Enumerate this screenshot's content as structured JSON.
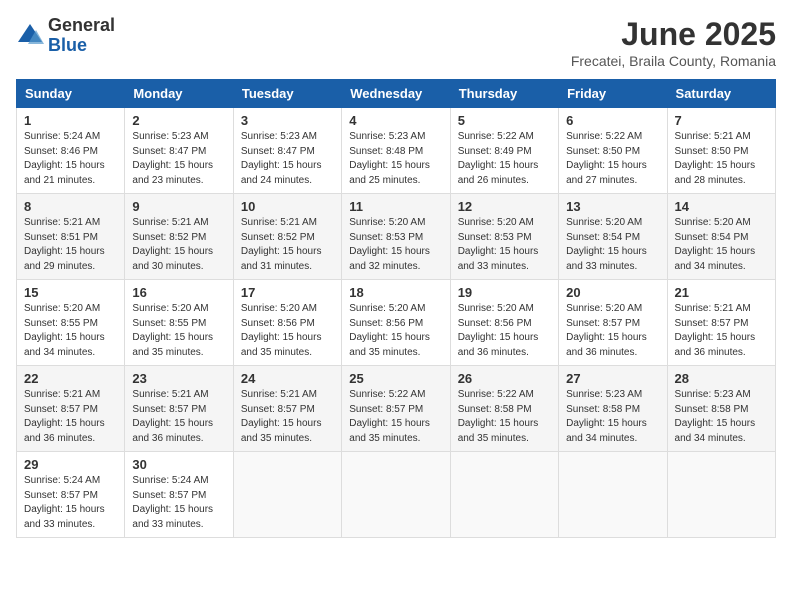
{
  "logo": {
    "general": "General",
    "blue": "Blue"
  },
  "title": "June 2025",
  "subtitle": "Frecatei, Braila County, Romania",
  "weekdays": [
    "Sunday",
    "Monday",
    "Tuesday",
    "Wednesday",
    "Thursday",
    "Friday",
    "Saturday"
  ],
  "weeks": [
    [
      {
        "day": "1",
        "sunrise": "5:24 AM",
        "sunset": "8:46 PM",
        "daylight": "15 hours and 21 minutes."
      },
      {
        "day": "2",
        "sunrise": "5:23 AM",
        "sunset": "8:47 PM",
        "daylight": "15 hours and 23 minutes."
      },
      {
        "day": "3",
        "sunrise": "5:23 AM",
        "sunset": "8:47 PM",
        "daylight": "15 hours and 24 minutes."
      },
      {
        "day": "4",
        "sunrise": "5:23 AM",
        "sunset": "8:48 PM",
        "daylight": "15 hours and 25 minutes."
      },
      {
        "day": "5",
        "sunrise": "5:22 AM",
        "sunset": "8:49 PM",
        "daylight": "15 hours and 26 minutes."
      },
      {
        "day": "6",
        "sunrise": "5:22 AM",
        "sunset": "8:50 PM",
        "daylight": "15 hours and 27 minutes."
      },
      {
        "day": "7",
        "sunrise": "5:21 AM",
        "sunset": "8:50 PM",
        "daylight": "15 hours and 28 minutes."
      }
    ],
    [
      {
        "day": "8",
        "sunrise": "5:21 AM",
        "sunset": "8:51 PM",
        "daylight": "15 hours and 29 minutes."
      },
      {
        "day": "9",
        "sunrise": "5:21 AM",
        "sunset": "8:52 PM",
        "daylight": "15 hours and 30 minutes."
      },
      {
        "day": "10",
        "sunrise": "5:21 AM",
        "sunset": "8:52 PM",
        "daylight": "15 hours and 31 minutes."
      },
      {
        "day": "11",
        "sunrise": "5:20 AM",
        "sunset": "8:53 PM",
        "daylight": "15 hours and 32 minutes."
      },
      {
        "day": "12",
        "sunrise": "5:20 AM",
        "sunset": "8:53 PM",
        "daylight": "15 hours and 33 minutes."
      },
      {
        "day": "13",
        "sunrise": "5:20 AM",
        "sunset": "8:54 PM",
        "daylight": "15 hours and 33 minutes."
      },
      {
        "day": "14",
        "sunrise": "5:20 AM",
        "sunset": "8:54 PM",
        "daylight": "15 hours and 34 minutes."
      }
    ],
    [
      {
        "day": "15",
        "sunrise": "5:20 AM",
        "sunset": "8:55 PM",
        "daylight": "15 hours and 34 minutes."
      },
      {
        "day": "16",
        "sunrise": "5:20 AM",
        "sunset": "8:55 PM",
        "daylight": "15 hours and 35 minutes."
      },
      {
        "day": "17",
        "sunrise": "5:20 AM",
        "sunset": "8:56 PM",
        "daylight": "15 hours and 35 minutes."
      },
      {
        "day": "18",
        "sunrise": "5:20 AM",
        "sunset": "8:56 PM",
        "daylight": "15 hours and 35 minutes."
      },
      {
        "day": "19",
        "sunrise": "5:20 AM",
        "sunset": "8:56 PM",
        "daylight": "15 hours and 36 minutes."
      },
      {
        "day": "20",
        "sunrise": "5:20 AM",
        "sunset": "8:57 PM",
        "daylight": "15 hours and 36 minutes."
      },
      {
        "day": "21",
        "sunrise": "5:21 AM",
        "sunset": "8:57 PM",
        "daylight": "15 hours and 36 minutes."
      }
    ],
    [
      {
        "day": "22",
        "sunrise": "5:21 AM",
        "sunset": "8:57 PM",
        "daylight": "15 hours and 36 minutes."
      },
      {
        "day": "23",
        "sunrise": "5:21 AM",
        "sunset": "8:57 PM",
        "daylight": "15 hours and 36 minutes."
      },
      {
        "day": "24",
        "sunrise": "5:21 AM",
        "sunset": "8:57 PM",
        "daylight": "15 hours and 35 minutes."
      },
      {
        "day": "25",
        "sunrise": "5:22 AM",
        "sunset": "8:57 PM",
        "daylight": "15 hours and 35 minutes."
      },
      {
        "day": "26",
        "sunrise": "5:22 AM",
        "sunset": "8:58 PM",
        "daylight": "15 hours and 35 minutes."
      },
      {
        "day": "27",
        "sunrise": "5:23 AM",
        "sunset": "8:58 PM",
        "daylight": "15 hours and 34 minutes."
      },
      {
        "day": "28",
        "sunrise": "5:23 AM",
        "sunset": "8:58 PM",
        "daylight": "15 hours and 34 minutes."
      }
    ],
    [
      {
        "day": "29",
        "sunrise": "5:24 AM",
        "sunset": "8:57 PM",
        "daylight": "15 hours and 33 minutes."
      },
      {
        "day": "30",
        "sunrise": "5:24 AM",
        "sunset": "8:57 PM",
        "daylight": "15 hours and 33 minutes."
      },
      null,
      null,
      null,
      null,
      null
    ]
  ]
}
